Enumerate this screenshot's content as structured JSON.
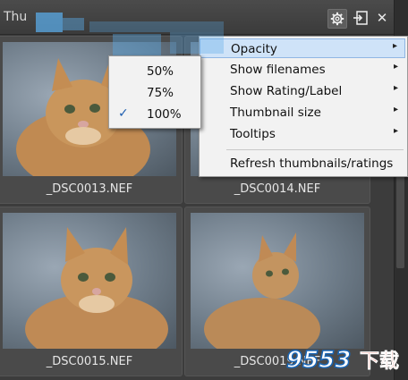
{
  "panel": {
    "title_partial": "Thu"
  },
  "toolbar": {
    "settings_icon": "gear-icon",
    "export_icon": "export-icon",
    "close_glyph": "✕"
  },
  "thumbnails": [
    {
      "filename": "_DSC0013.NEF"
    },
    {
      "filename": "_DSC0014.NEF"
    },
    {
      "filename": "_DSC0015.NEF"
    },
    {
      "filename": "_DSC0019.NEF"
    }
  ],
  "menu": {
    "items": [
      {
        "label": "Opacity",
        "has_submenu": true
      },
      {
        "label": "Show filenames",
        "has_submenu": true
      },
      {
        "label": "Show Rating/Label",
        "has_submenu": true
      },
      {
        "label": "Thumbnail size",
        "has_submenu": true
      },
      {
        "label": "Tooltips",
        "has_submenu": true
      },
      {
        "label": "Refresh thumbnails/ratings",
        "has_submenu": false
      }
    ],
    "arrow_glyph": "▸"
  },
  "opacity_submenu": {
    "items": [
      {
        "label": "50%",
        "checked": false
      },
      {
        "label": "75%",
        "checked": false
      },
      {
        "label": "100%",
        "checked": true
      }
    ],
    "check_glyph": "✓"
  },
  "watermark": {
    "text": "9553",
    "suffix": "下载"
  },
  "colors": {
    "menu_highlight": "#cfe3f8",
    "check": "#1f5fb0",
    "panel_bg": "#3c3c3c"
  }
}
